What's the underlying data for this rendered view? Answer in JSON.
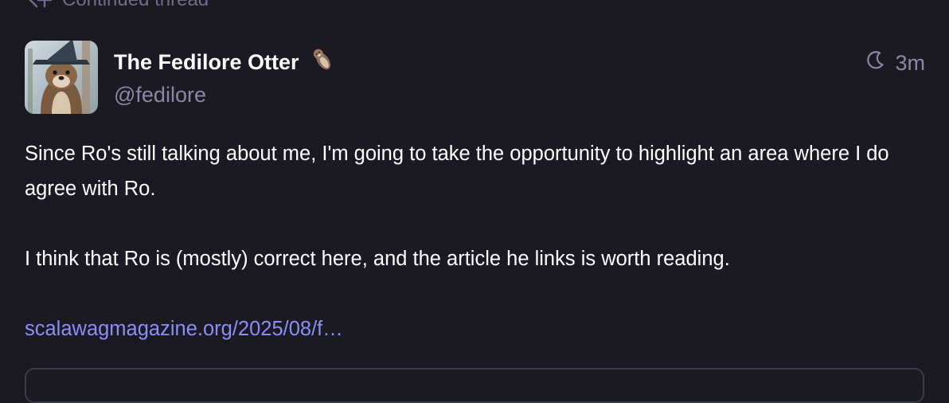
{
  "thread": {
    "label": "Continued thread"
  },
  "author": {
    "display_name": "The Fedilore Otter",
    "handle": "@fedilore"
  },
  "status": {
    "visibility_icon": "moon-icon",
    "relative_time": "3m",
    "paragraphs": [
      "Since Ro's still talking about me, I'm going to take the opportunity to highlight an area where I do agree with Ro.",
      "I think that Ro is (mostly) correct here, and the article he links is worth reading."
    ],
    "link_text": "scalawagmagazine.org/2025/08/f…"
  },
  "colors": {
    "background": "#1b1a22",
    "secondary_text": "#8a87a6",
    "link": "#8c8df7"
  }
}
